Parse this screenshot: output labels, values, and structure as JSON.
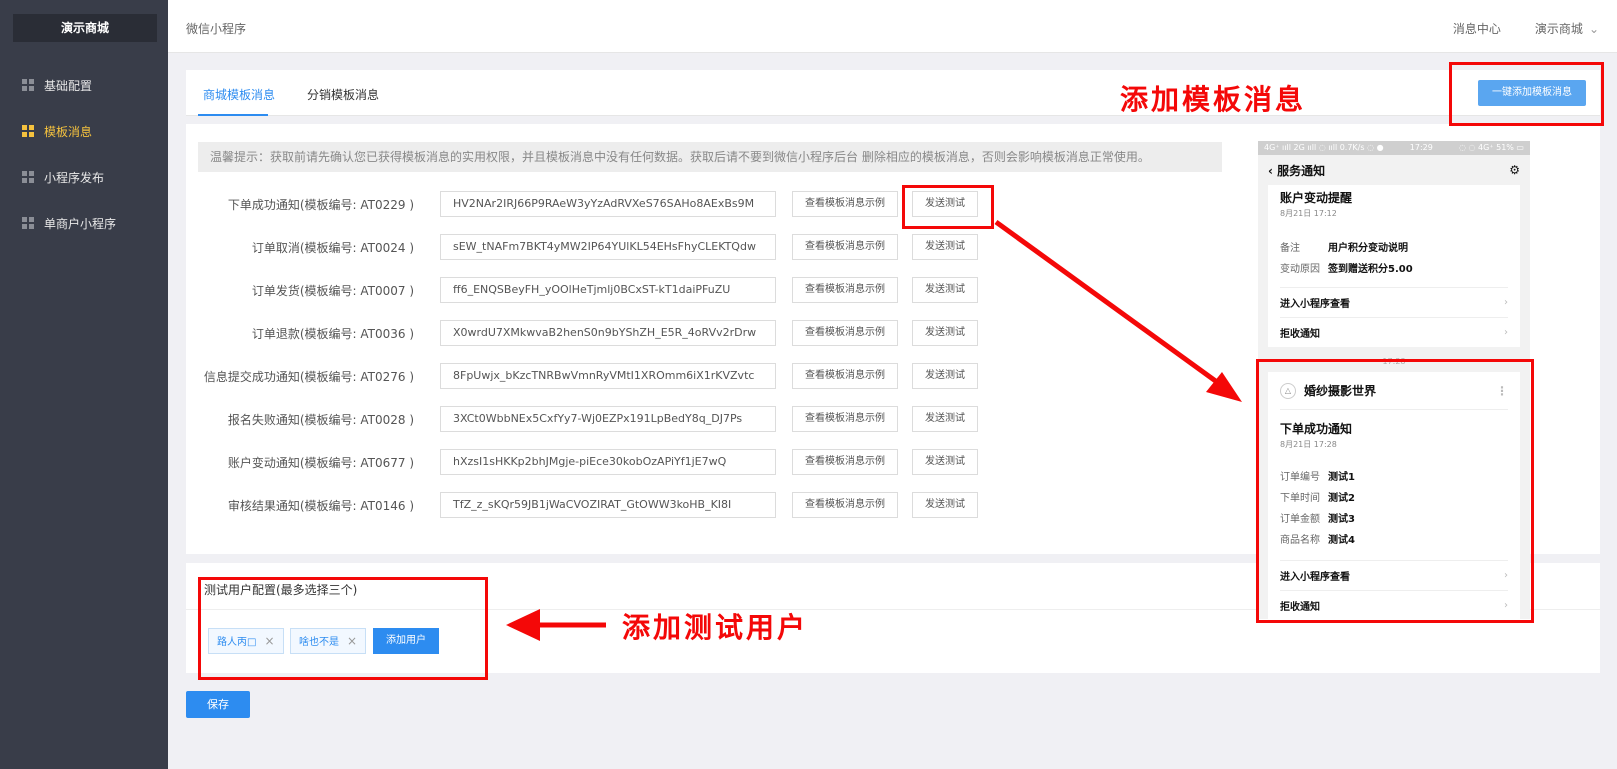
{
  "sidebar": {
    "brand": "演示商城",
    "items": [
      {
        "label": "基础配置"
      },
      {
        "label": "模板消息"
      },
      {
        "label": "小程序发布"
      },
      {
        "label": "单商户小程序"
      }
    ],
    "active_color": "#f5c23e"
  },
  "header": {
    "breadcrumb": "微信小程序",
    "message_center": "消息中心",
    "shop_menu": "演示商城"
  },
  "tabs": [
    {
      "label": "商城模板消息",
      "active": true
    },
    {
      "label": "分销模板消息",
      "active": false
    }
  ],
  "one_key_button": "一键添加模板消息",
  "notice": "温馨提示：获取前请先确认您已获得模板消息的实用权限，并且模板消息中没有任何数据。获取后请不要到微信小程序后台 删除相应的模板消息，否则会影响模板消息正常使用。",
  "view_example_label": "查看模板消息示例",
  "send_test_label": "发送测试",
  "templates": [
    {
      "label": "下单成功通知(模板编号: AT0229 )",
      "value": "HV2NAr2IRJ66P9RAeW3yYzAdRVXeS76SAHo8AExBs9M"
    },
    {
      "label": "订单取消(模板编号: AT0024 )",
      "value": "sEW_tNAFm7BKT4yMW2IP64YUlKL54EHsFhyCLEKTQdw"
    },
    {
      "label": "订单发货(模板编号: AT0007 )",
      "value": "ff6_ENQSBeyFH_yOOlHeTjmlj0BCxST-kT1daiPFuZU"
    },
    {
      "label": "订单退款(模板编号: AT0036 )",
      "value": "X0wrdU7XMkwvaB2henS0n9bYShZH_E5R_4oRVv2rDrw"
    },
    {
      "label": "信息提交成功通知(模板编号: AT0276 )",
      "value": "8FpUwjx_bKzcTNRBwVmnRyVMtI1XROmm6iX1rKVZvtc"
    },
    {
      "label": "报名失败通知(模板编号: AT0028 )",
      "value": "3XCt0WbbNEx5CxfYy7-Wj0EZPx191LpBedY8q_DJ7Ps"
    },
    {
      "label": "账户变动通知(模板编号: AT0677 )",
      "value": "hXzsI1sHKKp2bhJMgje-piEce30kobOzAPiYf1jE7wQ"
    },
    {
      "label": "审核结果通知(模板编号: AT0146 )",
      "value": "TfZ_z_sKQr59JB1jWaCVOZIRAT_GtOWW3koHB_KI8I"
    }
  ],
  "test_users": {
    "title": "测试用户配置(最多选择三个)",
    "users": [
      "路人丙□",
      "啥也不是"
    ],
    "add_label": "添加用户"
  },
  "save_label": "保存",
  "annotations": {
    "add_template": "添加模板消息",
    "add_test_user": "添加测试用户",
    "color": "#f40808"
  },
  "phone": {
    "status_left": "4G⁺ ııll 2G ııll ◌ ııll 0.7K/s ◌ ●",
    "status_time": "17:29",
    "status_right": "◌ ◌ 4G⁺ 51% ▭",
    "nav_title": "服务通知",
    "card1": {
      "title": "账户变动提醒",
      "date": "8月21日 17:12",
      "fields": [
        {
          "k": "备注",
          "v": "用户积分变动说明"
        },
        {
          "k": "变动原因",
          "v": "签到赠送积分5.00"
        }
      ]
    },
    "enter_mini_program": "进入小程序查看",
    "reject_notice": "拒收通知",
    "time2": "17:28",
    "app_name": "婚纱摄影世界",
    "card2": {
      "title": "下单成功通知",
      "date": "8月21日 17:28",
      "fields": [
        {
          "k": "订单编号",
          "v": "测试1"
        },
        {
          "k": "下单时间",
          "v": "测试2"
        },
        {
          "k": "订单金额",
          "v": "测试3"
        },
        {
          "k": "商品名称",
          "v": "测试4"
        }
      ]
    }
  }
}
